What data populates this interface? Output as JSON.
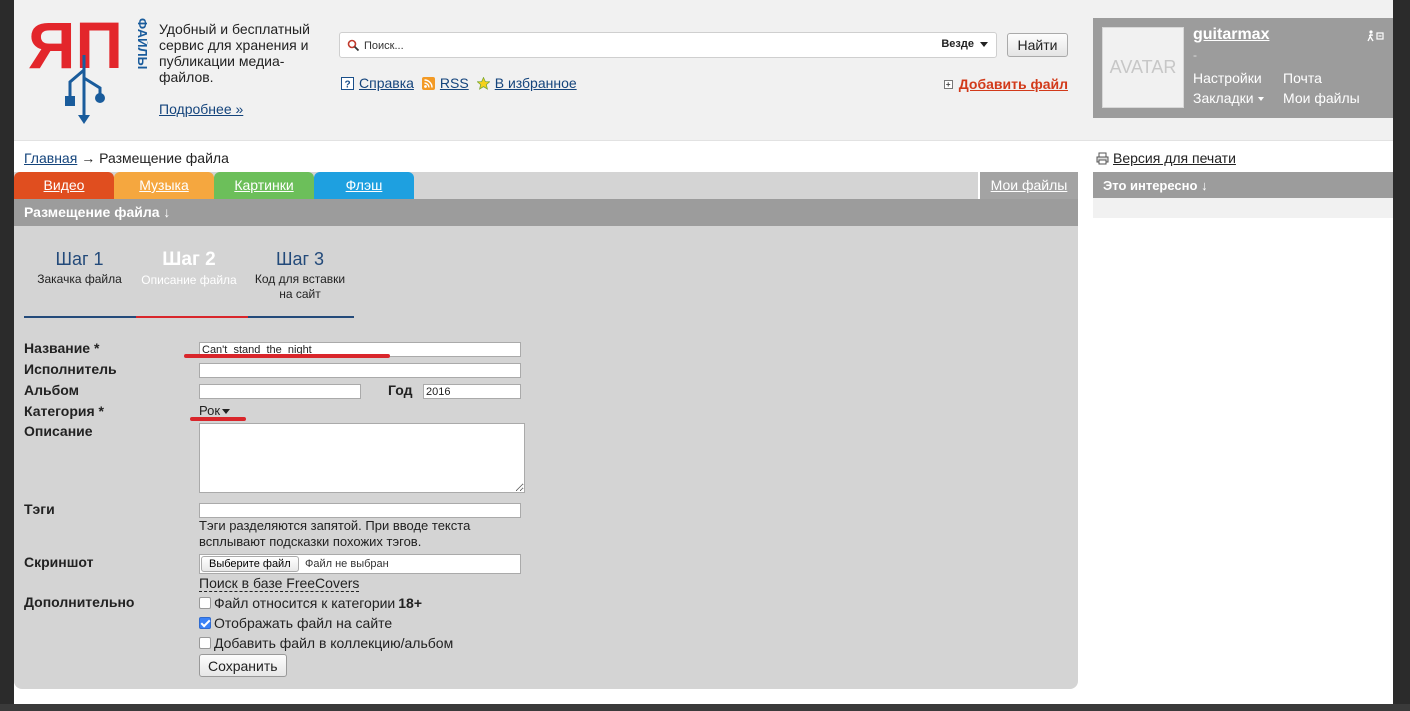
{
  "header": {
    "logo_text": "ЯП",
    "logo_sub": "ФАЙЛЫ",
    "tagline": "Удобный и бесплатный сервис для хранения и публикации медиа-файлов.",
    "more_link": "Подробнее »",
    "search": {
      "placeholder": "Поиск...",
      "scope": "Везде",
      "button": "Найти"
    },
    "links": [
      {
        "label": "Справка",
        "icon": "help-icon"
      },
      {
        "label": "RSS",
        "icon": "rss-icon"
      },
      {
        "label": "В избранное",
        "icon": "star-icon"
      }
    ],
    "add_file": "Добавить файл"
  },
  "user": {
    "avatar_text": "AVATAR",
    "name": "guitarmax",
    "status": "-",
    "menu": {
      "settings": "Настройки",
      "mail": "Почта",
      "bookmarks": "Закладки",
      "my_files": "Мои файлы"
    }
  },
  "breadcrumb": {
    "home": "Главная",
    "current": "→ Размещение файла"
  },
  "print_link": "Версия для печати",
  "sidebar": {
    "interest_title": "Это интересно ↓"
  },
  "tabs": [
    {
      "label": "Видео",
      "color": "#e04e1f"
    },
    {
      "label": "Музыка",
      "color": "#f5a73f"
    },
    {
      "label": "Картинки",
      "color": "#6cbf5a"
    },
    {
      "label": "Флэш",
      "color": "#1ea0e0"
    }
  ],
  "my_files_tab": "Мои файлы",
  "section_title": "Размещение файла ↓",
  "steps": [
    {
      "num": "Шаг 1",
      "desc": "Закачка файла"
    },
    {
      "num": "Шаг 2",
      "desc": "Описание файла"
    },
    {
      "num": "Шаг 3",
      "desc": "Код для вставки на сайт"
    }
  ],
  "form": {
    "labels": {
      "name": "Название *",
      "artist": "Исполнитель",
      "album": "Альбом",
      "year": "Год",
      "category": "Категория *",
      "description": "Описание",
      "tags": "Тэги",
      "screenshot": "Скриншот",
      "extra": "Дополнительно"
    },
    "values": {
      "name": "Can't_stand_the_night",
      "artist": "",
      "album": "",
      "year": "2016",
      "category": "Рок",
      "description": "",
      "tags": ""
    },
    "tags_hint": "Тэги разделяются запятой. При вводе текста всплывают подсказки похожих тэгов.",
    "file_button": "Выберите файл",
    "file_status": "Файл не выбран",
    "freecovers": "Поиск в базе FreeCovers",
    "checkboxes": [
      {
        "label": "Файл относится к категории ",
        "bold": "18+",
        "checked": false
      },
      {
        "label": "Отображать файл на сайте",
        "bold": "",
        "checked": true
      },
      {
        "label": "Добавить файл в коллекцию/альбом",
        "bold": "",
        "checked": false
      }
    ],
    "save": "Сохранить"
  },
  "colors": {
    "accent_red": "#d9262b",
    "link": "#14447c",
    "panel": "#d4d4d4",
    "panel_head": "#9c9c9c"
  }
}
